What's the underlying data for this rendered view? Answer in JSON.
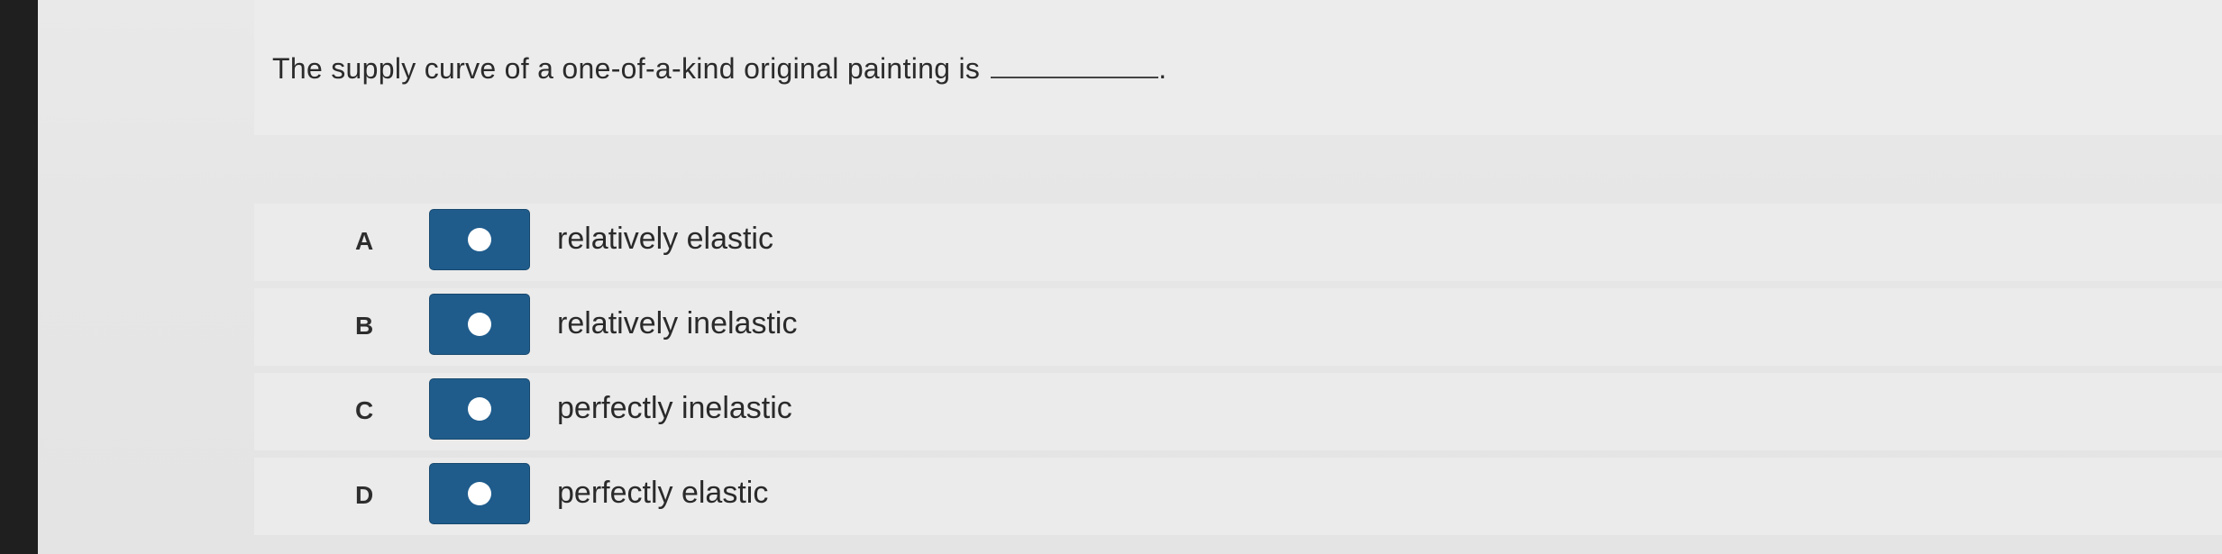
{
  "question": {
    "text": "The supply curve of a one-of-a-kind original painting is",
    "period": "."
  },
  "options": [
    {
      "letter": "A",
      "label": "relatively elastic"
    },
    {
      "letter": "B",
      "label": "relatively inelastic"
    },
    {
      "letter": "C",
      "label": "perfectly inelastic"
    },
    {
      "letter": "D",
      "label": "perfectly elastic"
    }
  ],
  "colors": {
    "button": "#1f5c8c",
    "background": "#e9e9e9",
    "bezel": "#1f1f1f"
  }
}
